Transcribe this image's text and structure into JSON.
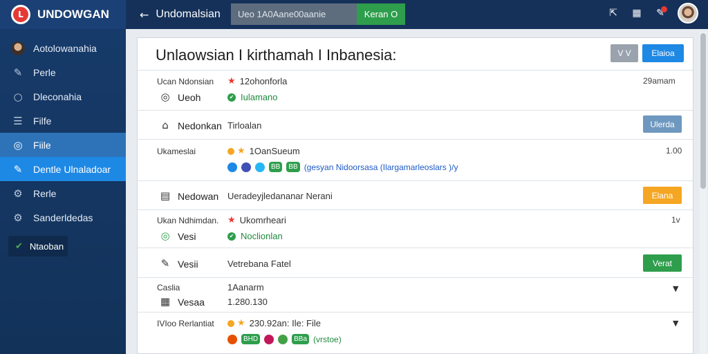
{
  "app": {
    "brand": "UNDOWGAN",
    "logo_letter": "L"
  },
  "sidebar": {
    "items": [
      {
        "label": "Aotolowanahia",
        "icon": "avatar"
      },
      {
        "label": "Perle",
        "icon": "wrench-icon"
      },
      {
        "label": "Dleconahia",
        "icon": "search-icon"
      },
      {
        "label": "Filfe",
        "icon": "list-icon"
      },
      {
        "label": "Fiile",
        "icon": "circle-icon"
      },
      {
        "label": "Dentle Ulnaladoar",
        "icon": "wrench-icon"
      },
      {
        "label": "Rerle",
        "icon": "gear-icon"
      },
      {
        "label": "Sanderldedas",
        "icon": "gear-icon"
      }
    ],
    "badge_label": "Ntaoban"
  },
  "topbar": {
    "back_glyph": "←",
    "title": "Undomalsian",
    "search_value": "Ueo 1A0Aane00aanie",
    "search_button": "Keran O"
  },
  "panel": {
    "title": "Unlaowsian I kirthamah I Inbanesia:",
    "header_btn_gray": "V V",
    "header_btn_blue": "Elaioa",
    "rows": {
      "r1": {
        "label": "Ucan Ndonsian",
        "value": "12ohonforla",
        "right": "29amam",
        "sub_label": "Ueoh",
        "sub_value": "Iulamano"
      },
      "r2": {
        "label": "Nedonkan",
        "value": "Tirloalan",
        "button": "Ulerda"
      },
      "r3": {
        "label": "Ukameslai",
        "value": "1OanSueum",
        "right": "1.00",
        "chips": [
          "BB",
          "BB"
        ],
        "link": "(gesyan Nidoorsasa (Ilargamarleoslars )/y"
      },
      "r4": {
        "label": "Nedowan",
        "value": "Ueradeyjledananar Nerani",
        "button": "Elana"
      },
      "r5": {
        "label": "Ukan Ndhimdan.",
        "value": "Ukomrheari",
        "right": "1v",
        "sub_label": "Vesi",
        "sub_value": "Noclionlan"
      },
      "r6": {
        "label": "Vesii",
        "value": "Vetrebana Fatel",
        "button": "Verat"
      },
      "r7": {
        "label": "Caslia",
        "value": "1Aanarm",
        "sub_label": "Vesaa",
        "sub_value": "1.280.130"
      },
      "r8": {
        "label": "IVIoo Rerlantiat",
        "value": "230.92an: Ile: File",
        "chips": [
          "BHD",
          "BBa"
        ],
        "link": "(vrstoe)"
      }
    }
  },
  "colors": {
    "sidebar": "#123259",
    "topbar": "#15315a",
    "accent_blue": "#1e88e5",
    "green": "#2e9e4c",
    "orange": "#f5a623",
    "red": "#e53935",
    "steel": "#6e98bf"
  }
}
